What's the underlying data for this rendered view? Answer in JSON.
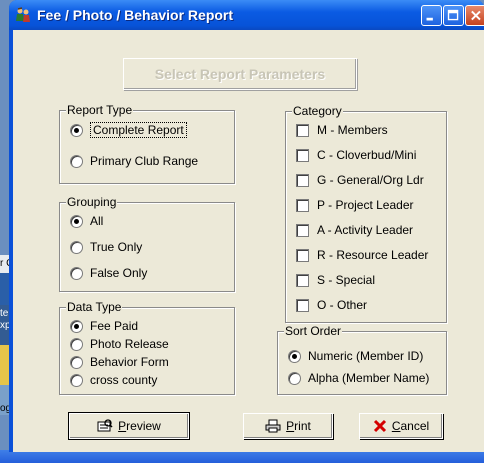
{
  "window": {
    "title": "Fee / Photo / Behavior Report",
    "icon": "app-people-icon"
  },
  "title_buttons": [
    "minimize",
    "maximize",
    "close"
  ],
  "banner": "Select Report Parameters",
  "report_type": {
    "label": "Report Type",
    "options": [
      {
        "label": "Complete Report",
        "selected": true
      },
      {
        "label": "Primary Club Range",
        "selected": false
      }
    ]
  },
  "grouping": {
    "label": "Grouping",
    "options": [
      {
        "label": "All",
        "selected": true
      },
      {
        "label": "True Only",
        "selected": false
      },
      {
        "label": "False Only",
        "selected": false
      }
    ]
  },
  "data_type": {
    "label": "Data Type",
    "options": [
      {
        "label": "Fee Paid",
        "selected": true
      },
      {
        "label": "Photo Release",
        "selected": false
      },
      {
        "label": "Behavior Form",
        "selected": false
      },
      {
        "label": "cross county",
        "selected": false
      }
    ]
  },
  "category": {
    "label": "Category",
    "items": [
      {
        "label": "M - Members",
        "checked": false
      },
      {
        "label": "C - Cloverbud/Mini",
        "checked": false
      },
      {
        "label": "G - General/Org Ldr",
        "checked": false
      },
      {
        "label": "P - Project Leader",
        "checked": false
      },
      {
        "label": "A - Activity Leader",
        "checked": false
      },
      {
        "label": "R - Resource Leader",
        "checked": false
      },
      {
        "label": "S - Special",
        "checked": false
      },
      {
        "label": "O - Other",
        "checked": false
      }
    ]
  },
  "sort_order": {
    "label": "Sort Order",
    "options": [
      {
        "label": "Numeric (Member ID)",
        "selected": true
      },
      {
        "label": "Alpha (Member Name)",
        "selected": false
      }
    ]
  },
  "buttons": {
    "preview": "Preview",
    "print": "Print",
    "cancel": "Cancel"
  },
  "desktop_fragments": [
    "r C",
    "te",
    "xpl",
    "og"
  ]
}
